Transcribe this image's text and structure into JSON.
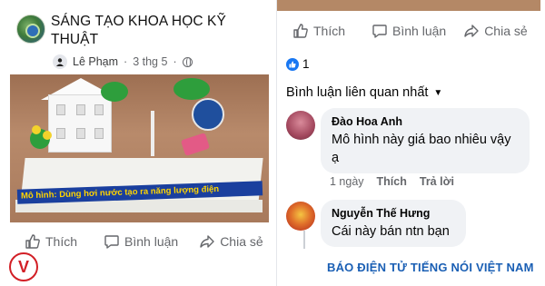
{
  "post": {
    "group_name": "SÁNG TẠO KHOA HỌC KỸ THUẬT",
    "author": "Lê Phạm",
    "time": "3 thg 5",
    "photo_caption": "Mô hình: Dùng hơi nước tạo ra năng lượng điện",
    "actions": {
      "like": "Thích",
      "comment": "Bình luận",
      "share": "Chia sẻ"
    }
  },
  "detail": {
    "actions": {
      "like": "Thích",
      "comment": "Bình luận",
      "share": "Chia sẻ"
    },
    "reaction_count": "1",
    "sort_label": "Bình luận liên quan nhất",
    "comments": [
      {
        "name": "Đào Hoa Anh",
        "text": "Mô hình này giá bao nhiêu vậy ạ",
        "time": "1 ngày",
        "like": "Thích",
        "reply": "Trả lời"
      },
      {
        "name": "Nguyễn Thế Hưng",
        "text": "Cái này bán ntn bạn"
      }
    ]
  },
  "watermark": {
    "brand": "BÁO ĐIỆN TỬ TIẾNG NÓI VIỆT NAM",
    "logo_letter": "V"
  },
  "colors": {
    "facebook_blue": "#1877f2",
    "vov_red": "#d21f26",
    "brand_blue": "#1a5fb4",
    "bubble_bg": "#f0f2f5"
  }
}
